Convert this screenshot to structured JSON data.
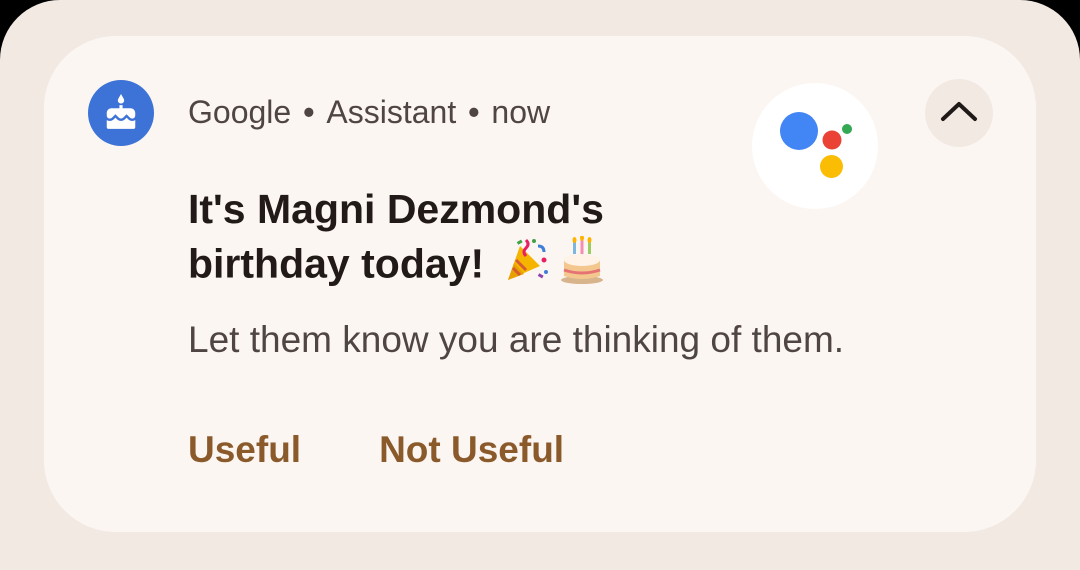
{
  "notification": {
    "app_name": "Google",
    "separator": "•",
    "source": "Assistant",
    "time": "now",
    "title": "It's Magni Dezmond's birthday today!",
    "emojis": [
      "party-popper",
      "birthday-cake"
    ],
    "body": "Let them know you are thinking of them.",
    "actions": {
      "useful_label": "Useful",
      "not_useful_label": "Not Useful"
    },
    "icons": {
      "app_icon": "birthday-cake-icon",
      "large_icon": "google-assistant-logo",
      "collapse": "chevron-up-icon"
    },
    "colors": {
      "app_icon_bg": "#3d73d6",
      "action_text": "#8a5a2b",
      "card_bg": "#fcf6f3",
      "shade_bg": "#f2e9e3",
      "assistant_blue": "#4285f4",
      "assistant_red": "#ea4335",
      "assistant_yellow": "#fbbc04",
      "assistant_green": "#34a853"
    }
  }
}
